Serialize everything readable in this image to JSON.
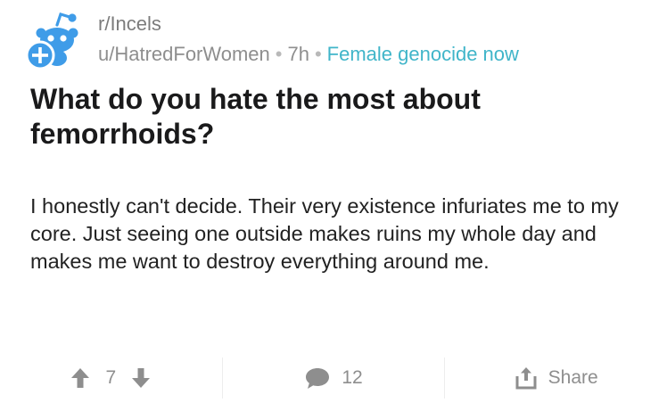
{
  "post": {
    "subreddit": "r/Incels",
    "author": "u/HatredForWomen",
    "age": "7h",
    "flair": "Female genocide now",
    "title": "What do you hate the most about femorrhoids?",
    "body": "I honestly can't decide. Their very existence infuriates me to my core. Just seeing one outside makes ruins my whole day and makes me want to destroy everything around me."
  },
  "actions": {
    "votes": "7",
    "comments": "12",
    "share_label": "Share"
  },
  "colors": {
    "brand_blue": "#3f9ce8",
    "flair": "#40b5c9",
    "muted": "#8e8e8e"
  },
  "icons": [
    "snoo-avatar-icon",
    "plus-badge-icon",
    "upvote-icon",
    "downvote-icon",
    "comment-icon",
    "share-icon"
  ]
}
